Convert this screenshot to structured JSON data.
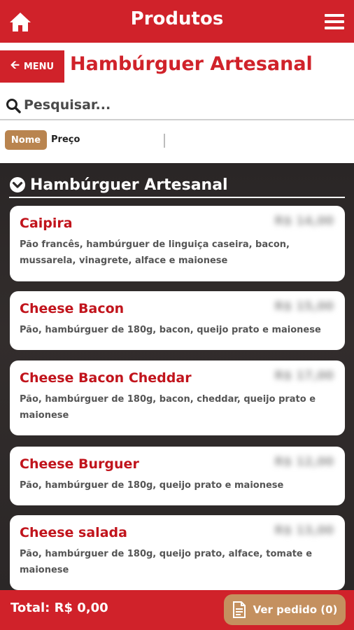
{
  "header": {
    "title": "Produtos",
    "home_icon": "home-icon",
    "menu_icon": "hamburger-menu-icon"
  },
  "nav": {
    "back_label": "MENU",
    "back_icon": "arrow-left-icon",
    "page_title": "Hambúrguer Artesanal"
  },
  "search": {
    "placeholder": "Pesquisar...",
    "value": "",
    "icon": "search-icon"
  },
  "sort": {
    "options": [
      "Nome",
      "Preço"
    ],
    "selected": "Nome"
  },
  "section": {
    "title": "Hambúrguer Artesanal",
    "icon": "chevron-down-circle-icon"
  },
  "products": [
    {
      "name": "Caipira",
      "description": "Pão francês, hambúrguer de linguiça caseira, bacon, mussarela, vinagrete, alface e maionese",
      "price": "R$ 14,00"
    },
    {
      "name": "Cheese Bacon",
      "description": "Pão, hambúrguer de 180g, bacon, queijo prato e maionese",
      "price": "R$ 15,00"
    },
    {
      "name": "Cheese Bacon Cheddar",
      "description": "Pão, hambúrguer de 180g, bacon, cheddar, queijo prato e maionese",
      "price": "R$ 17,00"
    },
    {
      "name": "Cheese Burguer",
      "description": "Pão, hambúrguer de 180g, queijo prato e maionese",
      "price": "R$ 12,00"
    },
    {
      "name": "Cheese salada",
      "description": "Pão, hambúrguer de 180g, queijo prato, alface, tomate e maionese",
      "price": "R$ 13,00"
    }
  ],
  "footer": {
    "total": "Total: R$ 0,00",
    "order_button": "Ver pedido (0)",
    "order_icon": "document-icon"
  },
  "colors": {
    "primary_red": "#d0222a",
    "accent_tan": "#b9844f",
    "dark_bg": "#2d2929"
  }
}
